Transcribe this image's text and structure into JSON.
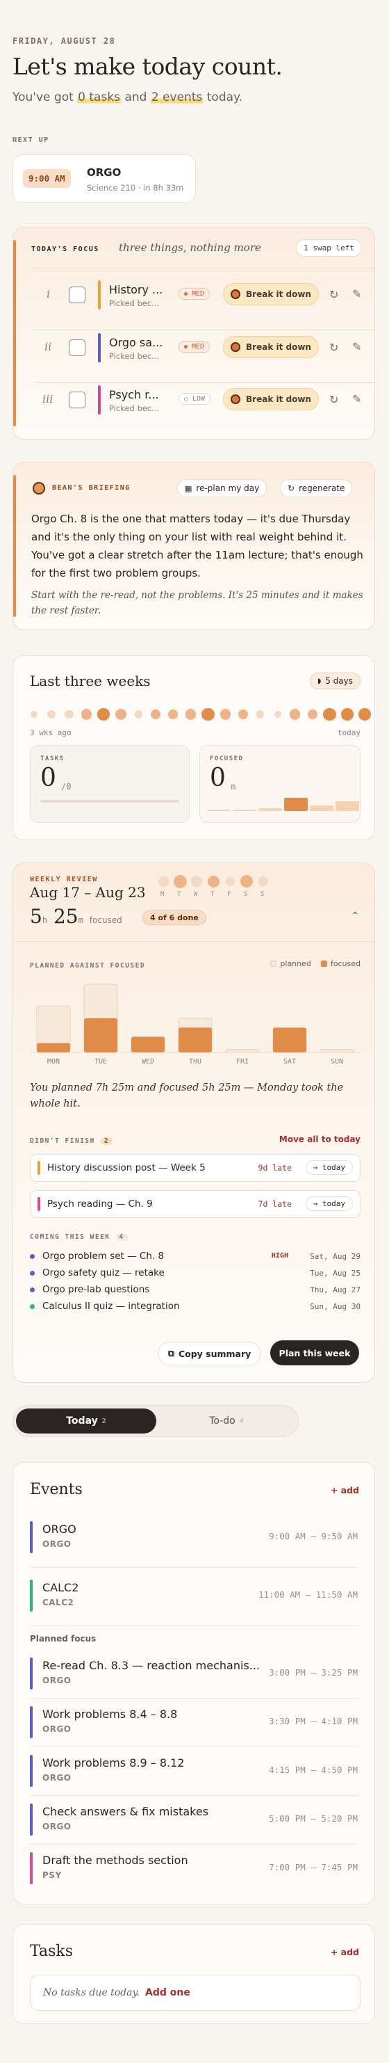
{
  "header": {
    "date": "FRIDAY, AUGUST 28",
    "title": "Let's make today count.",
    "sub_a": "You've got ",
    "tasks": "0 tasks",
    "sub_b": " and ",
    "events": "2 events",
    "sub_c": " today."
  },
  "next_up": {
    "label": "NEXT UP",
    "time": "9:00 AM",
    "title": "ORGO",
    "detail": "Science 210 · in 8h 33m"
  },
  "focus": {
    "label": "TODAY'S FOCUS",
    "tagline": "three things, nothing more",
    "swap": "1 swap left",
    "break_label": "Break it down",
    "items": [
      {
        "num": "i",
        "title": "History ...",
        "sub": "Picked bec...",
        "pri": "MED",
        "color": "#e8a33a"
      },
      {
        "num": "ii",
        "title": "Orgo sa...",
        "sub": "Picked bec...",
        "pri": "MED",
        "color": "#5b5bd6"
      },
      {
        "num": "iii",
        "title": "Psych r...",
        "sub": "Picked bec...",
        "pri": "LOW",
        "color": "#d94a8c"
      }
    ]
  },
  "briefing": {
    "label": "BEAN'S BRIEFING",
    "replan": "re-plan my day",
    "regen": "regenerate",
    "body": "Orgo Ch. 8 is the one that matters today — it's due Thursday and it's the only thing on your list with real weight behind it. You've got a clear stretch after the 11am lecture; that's enough for the first two problem groups.",
    "note": "Start with the re-read, not the problems. It's 25 minutes and it makes the rest faster."
  },
  "weeks": {
    "title": "Last three weeks",
    "streak": "5 days",
    "start": "3 wks ago",
    "end": "today",
    "dots": [
      0.2,
      0.4,
      0.4,
      0.6,
      0.8,
      0.7,
      0.3,
      0.5,
      0.5,
      0.6,
      0.9,
      0.6,
      0.5,
      0.3,
      0.2,
      0.6,
      0.5,
      0.9,
      0.8,
      0.8
    ],
    "tasks_label": "TASKS",
    "tasks_val": "0",
    "tasks_of": "/0",
    "focused_label": "FOCUSED",
    "focused_val": "0",
    "focused_unit": "m",
    "focused_bars": [
      0.05,
      0.1,
      0.15,
      0.8,
      0.35,
      0.6
    ]
  },
  "review": {
    "label": "WEEKLY REVIEW",
    "range": "Aug 17 – Aug 23",
    "days": [
      "M",
      "T",
      "W",
      "T",
      "F",
      "S",
      "S"
    ],
    "day_levels": [
      0.5,
      0.9,
      0.6,
      0.7,
      0.3,
      0.8,
      0.4
    ],
    "hours": "5",
    "h": "h",
    "mins": "25",
    "m": "m",
    "focused": "focused",
    "done": "4 of 6 done",
    "chart_label": "PLANNED AGAINST FOCUSED",
    "legend_planned": "planned",
    "legend_focused": "focused",
    "chart_data": {
      "type": "bar",
      "categories": [
        "MON",
        "TUE",
        "WED",
        "THU",
        "FRI",
        "SAT",
        "SUN"
      ],
      "series": [
        {
          "name": "planned",
          "values": [
            75,
            110,
            25,
            55,
            5,
            25,
            5
          ]
        },
        {
          "name": "focused",
          "values": [
            15,
            55,
            25,
            40,
            0,
            40,
            0
          ]
        }
      ]
    },
    "summary": "You planned 7h 25m and focused 5h 25m — Monday took the whole hit.",
    "didnt_label": "DIDN'T FINISH",
    "didnt_count": "2",
    "move_all": "Move all to today",
    "didnt": [
      {
        "title": "History discussion post — Week 5",
        "late": "9d late",
        "btn": "→ today",
        "color": "#e8a33a"
      },
      {
        "title": "Psych reading — Ch. 9",
        "late": "7d late",
        "btn": "→ today",
        "color": "#d94a8c"
      }
    ],
    "coming_label": "COMING THIS WEEK",
    "coming_count": "4",
    "coming": [
      {
        "title": "Orgo problem set — Ch. 8",
        "high": "HIGH",
        "date": "Sat, Aug 29",
        "color": "#5b5bd6"
      },
      {
        "title": "Orgo safety quiz — retake",
        "high": "",
        "date": "Tue, Aug 25",
        "color": "#5b5bd6"
      },
      {
        "title": "Orgo pre-lab questions",
        "high": "",
        "date": "Thu, Aug 27",
        "color": "#5b5bd6"
      },
      {
        "title": "Calculus II quiz — integration",
        "high": "",
        "date": "Sun, Aug 30",
        "color": "#2bb673"
      }
    ],
    "copy": "Copy summary",
    "plan": "Plan this week"
  },
  "tabs": {
    "today": "Today",
    "today_n": "2",
    "todo": "To-do",
    "todo_n": "4"
  },
  "events": {
    "title": "Events",
    "add": "+ add",
    "planned_label": "Planned focus",
    "items": [
      {
        "title": "ORGO",
        "sub": "ORGO",
        "time": "9:00 AM – 9:50 AM",
        "color": "#5b5bd6"
      },
      {
        "title": "CALC2",
        "sub": "CALC2",
        "time": "11:00 AM – 11:50 AM",
        "color": "#2bb673"
      }
    ],
    "planned": [
      {
        "title": "Re-read Ch. 8.3 — reaction mechanis...",
        "sub": "ORGO",
        "time": "3:00 PM – 3:25 PM",
        "color": "#5b5bd6"
      },
      {
        "title": "Work problems 8.4 – 8.8",
        "sub": "ORGO",
        "time": "3:30 PM – 4:10 PM",
        "color": "#5b5bd6"
      },
      {
        "title": "Work problems 8.9 – 8.12",
        "sub": "ORGO",
        "time": "4:15 PM – 4:50 PM",
        "color": "#5b5bd6"
      },
      {
        "title": "Check answers & fix mistakes",
        "sub": "ORGO",
        "time": "5:00 PM – 5:20 PM",
        "color": "#5b5bd6"
      },
      {
        "title": "Draft the methods section",
        "sub": "PSY",
        "time": "7:00 PM – 7:45 PM",
        "color": "#d94a8c"
      }
    ]
  },
  "tasks": {
    "title": "Tasks",
    "add": "+ add",
    "empty": "No tasks due today.",
    "add_one": "Add one"
  },
  "colors": {
    "accent": "#e28c4a",
    "dark": "#2a2522"
  }
}
